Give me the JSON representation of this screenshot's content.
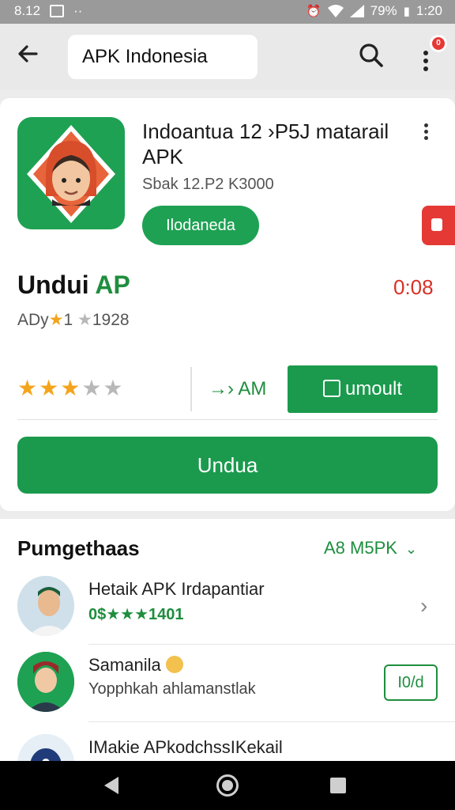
{
  "status_bar": {
    "time_left": "8.12",
    "signal_dots": "··",
    "battery": "79%",
    "time_right": "1:20"
  },
  "toolbar": {
    "search_text": "APK Indonesia",
    "more_badge": "0"
  },
  "app": {
    "title": "Indoantua 12 ›P5J matarail APK",
    "meta": "Sbak 12.P2 K3000",
    "tag": "Ilodaneda"
  },
  "section": {
    "title_black": "Undui",
    "title_green": " AP",
    "timer": "0:08",
    "rating_prefix": "ADy",
    "rating_star1": "★",
    "rating_value1": "1",
    "rating_star2": "★",
    "rating_value2": "1928"
  },
  "actions": {
    "stars_on": "★★★",
    "stars_off": "★★",
    "arrow_text": "→›",
    "am_text": "AM",
    "umount_label": "umoult",
    "main_button": "Undua"
  },
  "list": {
    "title": "Pumgethaas",
    "filter": "A8  M5PK",
    "filter_chevron": "⌄",
    "items": [
      {
        "title": "Hetaik APK Irdapantiar",
        "sub": "0$★★★1401",
        "chevron": "›"
      },
      {
        "title": "Samanila",
        "sub": "Yopphkah ahlamanstlak",
        "button": "I0/d"
      },
      {
        "title": "IMakie APkodchssIKekail"
      }
    ]
  },
  "colors": {
    "brand_green": "#1b9a4d",
    "accent_red": "#e53935",
    "star_gold": "#f4a41c"
  }
}
